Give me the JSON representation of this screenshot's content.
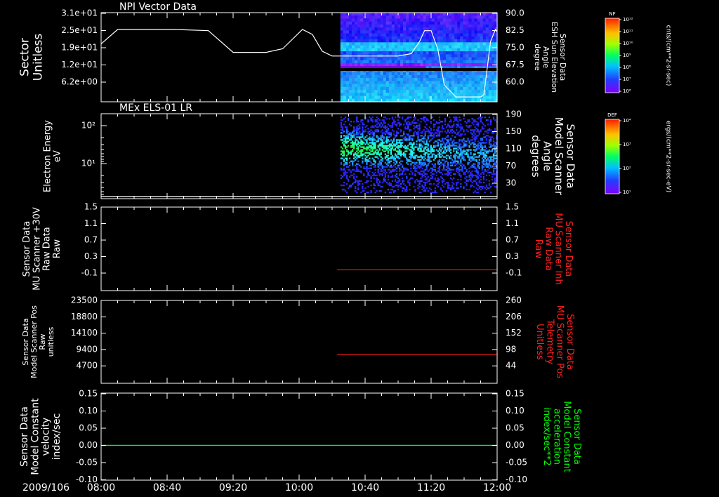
{
  "colors": {
    "background": "#000000",
    "axis": "#ffffff",
    "trace_white": "#ffffff",
    "trace_red": "#ff1a1a",
    "trace_green": "#00ff00",
    "label_red": "#ff2020",
    "label_green": "#00ff00"
  },
  "time_axis": {
    "date_label": "2009/106",
    "start": "08:00",
    "end": "12:00",
    "ticks": [
      "08:00",
      "08:40",
      "09:20",
      "10:00",
      "10:40",
      "11:20",
      "12:00"
    ]
  },
  "colorbars": [
    {
      "label": "NF",
      "units": "cnts/(cm**2-sr-sec)",
      "tick_labels": [
        "10¹²",
        "10¹¹",
        "10¹⁰",
        "10⁹",
        "10⁸",
        "10⁷",
        "10⁶"
      ]
    },
    {
      "label": "DEF",
      "units": "ergs/(cm**2-sr-sec-eV)",
      "tick_labels": [
        "10⁴",
        "10³",
        "10²",
        "10¹"
      ]
    }
  ],
  "chart_data": [
    {
      "type": "heatmap",
      "title": "NPI Vector Data",
      "left_axis_label": [
        "Sector",
        "Unitless"
      ],
      "left_ticks": [
        "3.1e+01",
        "2.5e+01",
        "1.9e+01",
        "1.2e+01",
        "6.2e+00"
      ],
      "right_axis_label": [
        "Sensor Data",
        "ESH Sun Elevation",
        "Angle",
        "degree"
      ],
      "right_ticks": [
        "90.0",
        "82.5",
        "75.0",
        "67.5",
        "60.0"
      ],
      "right_ylim": [
        53,
        90
      ],
      "spectrogram_start": "10:25",
      "line_series": {
        "name": "ESH Sun Elevation Angle",
        "color": "white",
        "x": [
          "08:00",
          "08:10",
          "08:25",
          "08:45",
          "09:05",
          "09:20",
          "09:40",
          "09:50",
          "10:02",
          "10:08",
          "10:14",
          "10:20",
          "10:40",
          "11:00",
          "11:08",
          "11:13",
          "11:16",
          "11:20",
          "11:24",
          "11:28",
          "11:35",
          "11:37",
          "11:50",
          "11:52",
          "11:56",
          "11:59",
          "12:00"
        ],
        "y": [
          77,
          83,
          83,
          83,
          82.5,
          73.5,
          73.5,
          75,
          83,
          81,
          74,
          72,
          72,
          72,
          73,
          78,
          82.5,
          82.5,
          75,
          60,
          55,
          55,
          55,
          56,
          78,
          83,
          82
        ]
      }
    },
    {
      "type": "heatmap",
      "title": "MEx ELS-01 LR",
      "left_axis_label": [
        "Electron Energy",
        "eV"
      ],
      "left_ticks": [
        "10²",
        "10¹"
      ],
      "right_axis_label": [
        "Sensor Data",
        "Model Scanner",
        "Angle",
        "degrees"
      ],
      "right_ticks": [
        "190",
        "150",
        "110",
        "70",
        "30"
      ],
      "right_ylim": [
        -5,
        190
      ],
      "spectrogram_start": "10:25",
      "line_series": {
        "name": "Model Scanner Angle",
        "color": "white",
        "x": [
          "08:00",
          "12:00"
        ],
        "y": [
          0,
          0
        ]
      }
    },
    {
      "type": "line",
      "title": "",
      "left_axis_label": [
        "Sensor Data",
        "MU Scanner +30V",
        "Raw Data",
        "Raw"
      ],
      "left_ticks": [
        "1.5",
        "1.1",
        "0.7",
        "0.3",
        "-0.1"
      ],
      "right_axis_label": [
        "Sensor Data",
        "MU Scanner Inh",
        "Raw Data",
        "Raw"
      ],
      "right_ticks": [
        "1.5",
        "1.1",
        "0.7",
        "0.3",
        "-0.1"
      ],
      "ylim": [
        -0.5,
        1.5
      ],
      "series": [
        {
          "color": "red",
          "x": [
            "10:23",
            "12:00"
          ],
          "y": [
            0,
            0
          ]
        }
      ]
    },
    {
      "type": "line",
      "title": "",
      "left_axis_label": [
        "Sensor Data",
        "Model Scanner Pos",
        "Raw",
        "unitless"
      ],
      "left_ticks": [
        "23500",
        "18800",
        "14100",
        "9400",
        "4700"
      ],
      "right_axis_label": [
        "Sensor Data",
        "MU Scanner Pos",
        "Telemetry",
        "Unitless"
      ],
      "right_ticks": [
        "260",
        "206",
        "152",
        "98",
        "44"
      ],
      "ylim": [
        0,
        23500
      ],
      "right_ylim": [
        0,
        260
      ],
      "series": [
        {
          "color": "red",
          "x": [
            "10:23",
            "12:00"
          ],
          "y": [
            8200,
            8200
          ]
        }
      ]
    },
    {
      "type": "line",
      "title": "",
      "left_axis_label": [
        "Sensor Data",
        "Model Constant",
        "velocity",
        "index/sec"
      ],
      "left_ticks": [
        "0.15",
        "0.10",
        "0.05",
        "0.00",
        "-0.05",
        "-0.10"
      ],
      "right_axis_label": [
        "Sensor Data",
        "Model Constant",
        "acceleration",
        "index/sec**2"
      ],
      "right_ticks": [
        "0.15",
        "0.10",
        "0.05",
        "0.00",
        "-0.05",
        "-0.10"
      ],
      "ylim": [
        -0.1,
        0.15
      ],
      "series": [
        {
          "color": "green",
          "x": [
            "08:00",
            "12:00"
          ],
          "y": [
            0,
            0
          ]
        }
      ]
    }
  ]
}
